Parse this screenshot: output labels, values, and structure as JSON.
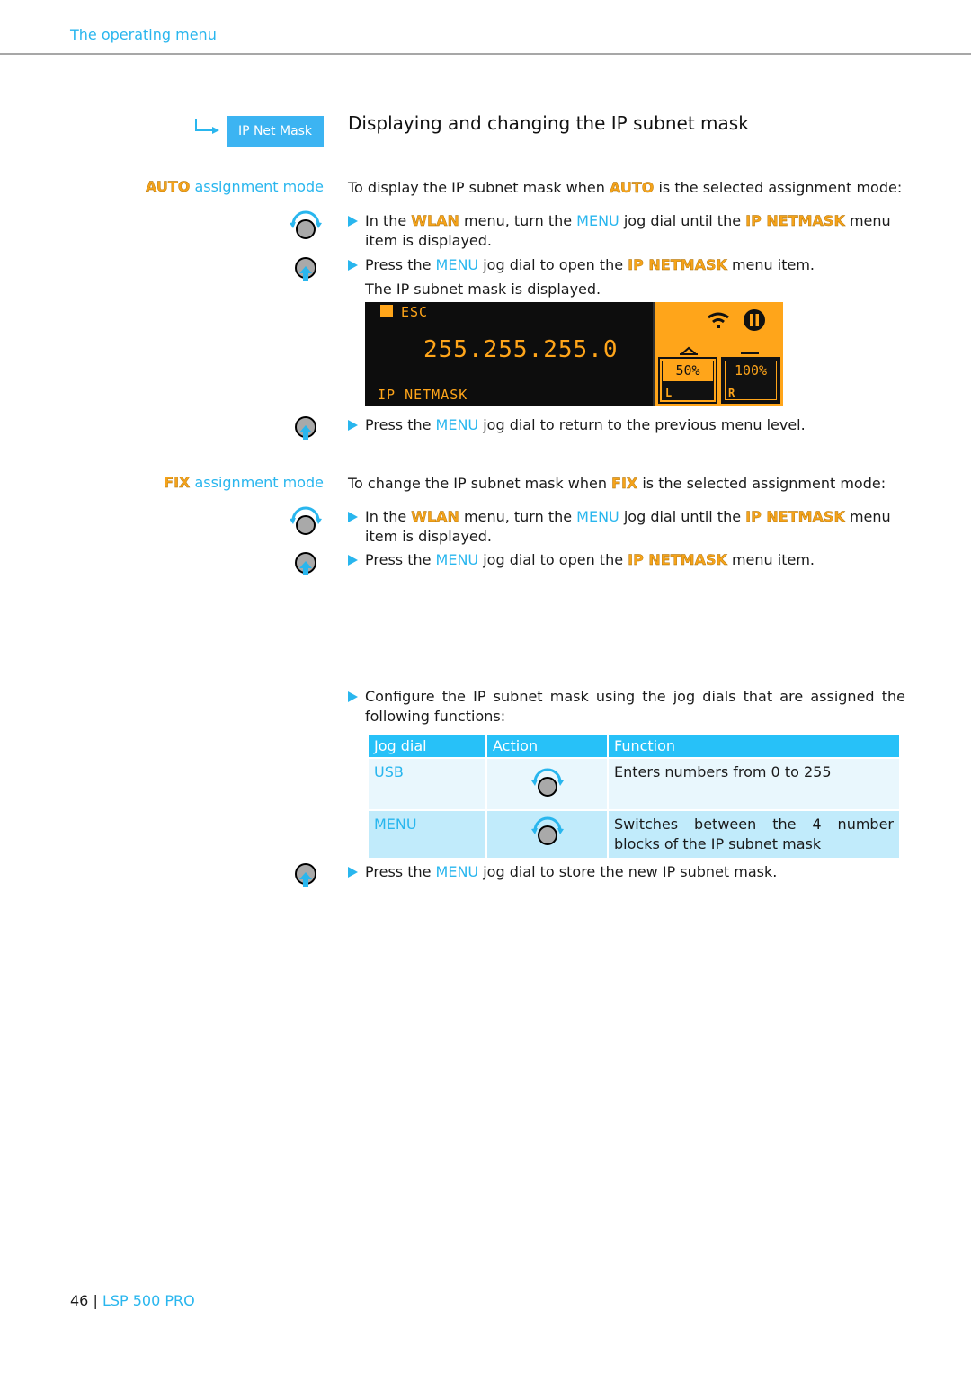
{
  "header": {
    "section": "The operating menu"
  },
  "nav_chip": {
    "label": "IP Net Mask",
    "icon": "arrow-right-icon"
  },
  "title": "Displaying and changing the IP subnet mask",
  "auto": {
    "side_label_hl": "AUTO",
    "side_label_rest": " assignment mode",
    "intro_pre": "To display the IP subnet mask when ",
    "intro_hl": "AUTO",
    "intro_post": " is the selected assignment mode:",
    "step1": {
      "a": "In the ",
      "wlan": "WLAN",
      "b": " menu, turn the ",
      "menu": "MENU",
      "c": " jog dial until the ",
      "item": "IP NETMASK",
      "d": " menu item is displayed."
    },
    "step2": {
      "a": "Press the ",
      "menu": "MENU",
      "b": " jog dial to open the ",
      "item": "IP NETMASK",
      "c": " menu item."
    },
    "result": "The IP subnet mask is displayed.",
    "step3": {
      "a": "Press the ",
      "menu": "MENU",
      "b": " jog dial to return to the previous menu level."
    }
  },
  "display": {
    "esc": "ESC",
    "value": "255.255.255.0",
    "menu_name": "IP NETMASK",
    "icons": [
      "wifi-icon",
      "pause-icon",
      "mute-indicator-icon"
    ],
    "channels": [
      {
        "percent": "50%",
        "letter": "L"
      },
      {
        "percent": "100%",
        "letter": "R"
      }
    ],
    "colors": {
      "amber": "#ffa51a",
      "background": "#0d0d0d"
    }
  },
  "fix": {
    "side_label_hl": "FIX",
    "side_label_rest": " assignment mode",
    "intro_pre": "To change the IP subnet mask when ",
    "intro_hl": "FIX",
    "intro_post": " is the selected assignment mode:",
    "step1": {
      "a": "In the ",
      "wlan": "WLAN",
      "b": " menu, turn the ",
      "menu": "MENU",
      "c": " jog dial until the ",
      "item": "IP NETMASK",
      "d": " menu item is displayed."
    },
    "step2": {
      "a": "Press the ",
      "menu": "MENU",
      "b": " jog dial to open the ",
      "item": "IP NETMASK",
      "c": " menu item."
    },
    "step3": "Configure the IP subnet mask using the jog dials that are assigned the following functions:",
    "step4": {
      "a": "Press the ",
      "menu": "MENU",
      "b": " jog dial to store the new IP subnet mask."
    }
  },
  "table": {
    "headers": [
      "Jog dial",
      "Action",
      "Function"
    ],
    "rows": [
      {
        "dial": "USB",
        "action": "rotate-dial-icon",
        "function": "Enters numbers from 0 to 255"
      },
      {
        "dial": "MENU",
        "action": "rotate-dial-icon",
        "function": "Switches between the 4 number blocks of the IP subnet mask"
      }
    ]
  },
  "footer": {
    "page": "46",
    "separator": "|",
    "product": "LSP 500 PRO"
  },
  "colors": {
    "accent": "#29b6ee",
    "highlight": "#f5a31a",
    "table_header": "#27c1f8"
  }
}
